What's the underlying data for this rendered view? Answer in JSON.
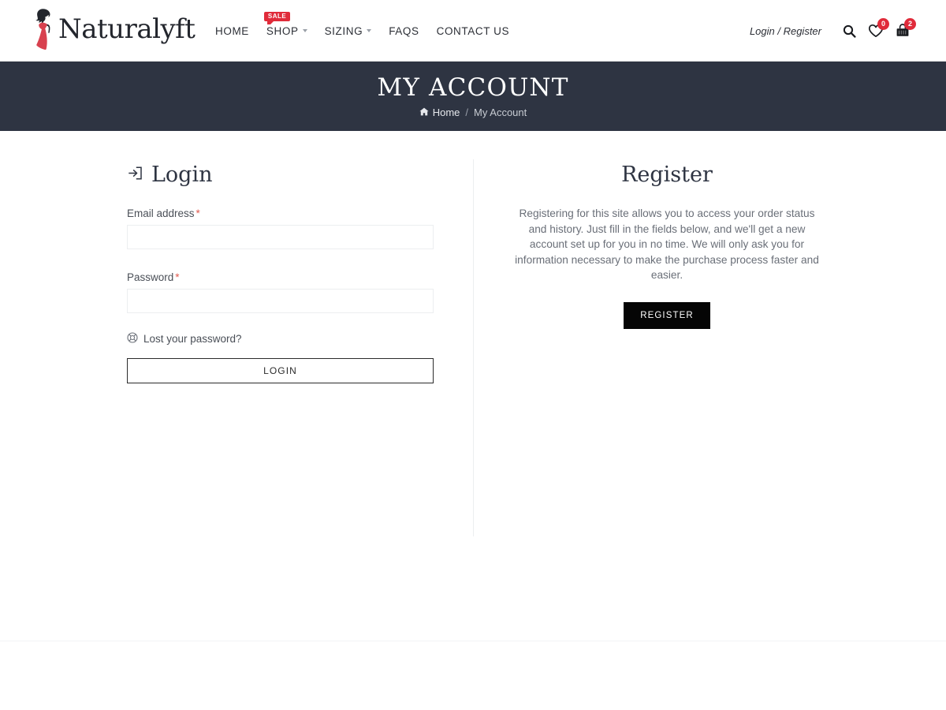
{
  "header": {
    "logo_text": "Naturalyft",
    "logo_icon": "woman-silhouette-logo-icon",
    "nav": [
      {
        "label": "HOME",
        "has_caret": false,
        "badge": ""
      },
      {
        "label": "SHOP",
        "has_caret": true,
        "badge": "SALE"
      },
      {
        "label": "SIZING",
        "has_caret": true,
        "badge": ""
      },
      {
        "label": "FAQS",
        "has_caret": false,
        "badge": ""
      },
      {
        "label": "CONTACT US",
        "has_caret": false,
        "badge": ""
      }
    ],
    "login_register": "Login / Register",
    "search_icon": "search-icon",
    "wishlist_icon": "heart-icon",
    "wishlist_count": "0",
    "cart_icon": "shopping-bag-icon",
    "cart_count": "2"
  },
  "banner": {
    "title": "MY ACCOUNT",
    "breadcrumb_home": "Home",
    "breadcrumb_sep": "/",
    "breadcrumb_current": "My Account",
    "home_icon": "home-icon",
    "background": "#2e3442"
  },
  "login": {
    "heading": "Login",
    "heading_icon": "sign-in-icon",
    "email_label": "Email address",
    "email_required": "*",
    "email_value": "",
    "email_placeholder": "",
    "password_label": "Password",
    "password_required": "*",
    "password_value": "",
    "password_placeholder": "",
    "lost_password": "Lost your password?",
    "lost_password_icon": "lifebuoy-icon",
    "submit_label": "LOGIN"
  },
  "register": {
    "heading": "Register",
    "description": "Registering for this site allows you to access your order status and history. Just fill in the fields below, and we'll get a new account set up for you in no time. We will only ask you for information necessary to make the purchase process faster and easier.",
    "submit_label": "REGISTER",
    "submit_background": "#050505"
  },
  "theme": {
    "accent_red": "#e02b3a",
    "dark_navy": "#2e3442",
    "required_red": "#e05a4f"
  }
}
